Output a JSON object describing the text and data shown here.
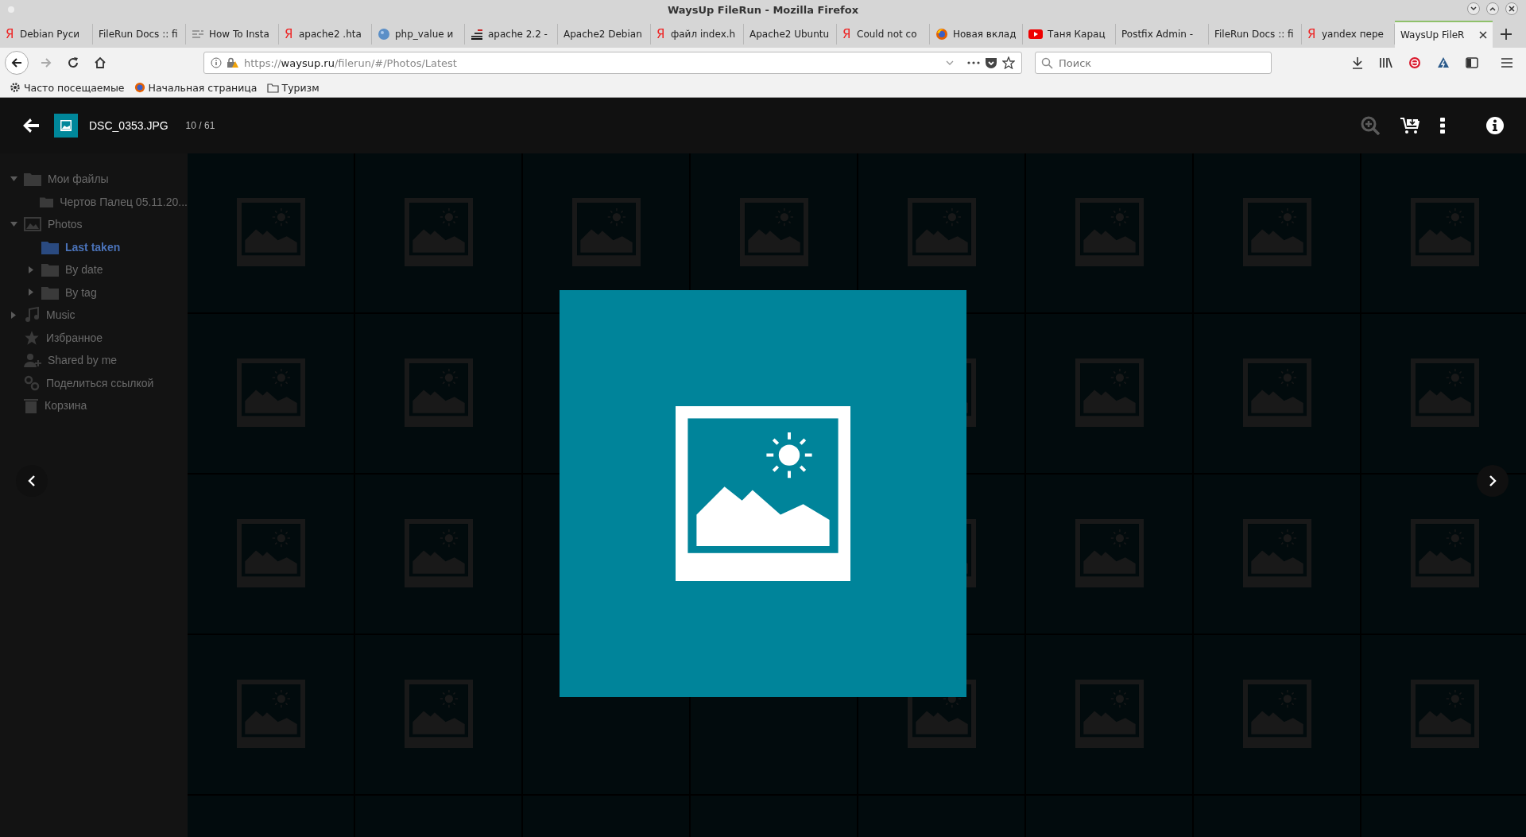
{
  "window": {
    "title": "WaysUp FileRun - Mozilla Firefox"
  },
  "tabs": [
    {
      "label": "Debian Руси",
      "kind": "yandex",
      "mark": "Я",
      "selected": false
    },
    {
      "label": "FileRun Docs :: fi",
      "kind": "plain",
      "selected": false
    },
    {
      "label": "How To Insta",
      "kind": "lines",
      "selected": false
    },
    {
      "label": "apache2 .hta",
      "kind": "yandex",
      "mark": "Я",
      "selected": false
    },
    {
      "label": "php_value и",
      "kind": "globe",
      "selected": false
    },
    {
      "label": "apache 2.2 -",
      "kind": "bars",
      "selected": false
    },
    {
      "label": "Apache2 Debian",
      "kind": "plain",
      "selected": false
    },
    {
      "label": "файл index.h",
      "kind": "yandex",
      "mark": "Я",
      "selected": false
    },
    {
      "label": "Apache2 Ubuntu",
      "kind": "plain",
      "selected": false
    },
    {
      "label": "Could not co",
      "kind": "yandex",
      "mark": "Я",
      "selected": false
    },
    {
      "label": "Новая вклад",
      "kind": "firefox",
      "selected": false
    },
    {
      "label": "Таня Карац",
      "kind": "youtube",
      "selected": false
    },
    {
      "label": "Postfix Admin -",
      "kind": "plain",
      "selected": false
    },
    {
      "label": "FileRun Docs :: fi",
      "kind": "plain",
      "selected": false
    },
    {
      "label": "yandex пере",
      "kind": "yandex",
      "mark": "Я",
      "selected": false
    },
    {
      "label": "WaysUp FileR",
      "kind": "plain",
      "selected": true
    }
  ],
  "address": {
    "scheme": "https://",
    "host": "waysup.ru",
    "path": "/filerun/#/Photos/Latest"
  },
  "search": {
    "placeholder": "Поиск"
  },
  "bookmarks": [
    {
      "label": "Часто посещаемые",
      "kind": "gear"
    },
    {
      "label": "Начальная страница",
      "kind": "firefox"
    },
    {
      "label": "Туризм",
      "kind": "folder"
    }
  ],
  "sidebar": {
    "items": [
      {
        "label": "Мои файлы",
        "kind": "folder",
        "expanded": true,
        "selected": false,
        "children": [
          {
            "label": "Чертов Палец 05.11.20...",
            "kind": "folder",
            "selected": false
          }
        ]
      },
      {
        "label": "Photos",
        "kind": "photo",
        "expanded": true,
        "selected": false,
        "children": [
          {
            "label": "Last taken",
            "kind": "folder",
            "selected": true
          },
          {
            "label": "By date",
            "kind": "folder",
            "expanded": false,
            "selected": false
          },
          {
            "label": "By tag",
            "kind": "folder",
            "expanded": false,
            "selected": false
          }
        ]
      },
      {
        "label": "Music",
        "kind": "music",
        "expanded": false,
        "selected": false
      },
      {
        "label": "Избранное",
        "kind": "star",
        "selected": false
      },
      {
        "label": "Shared by me",
        "kind": "user",
        "selected": false
      },
      {
        "label": "Поделиться ссылкой",
        "kind": "link",
        "selected": false
      },
      {
        "label": "Корзина",
        "kind": "trash",
        "selected": false
      }
    ]
  },
  "viewer": {
    "filename": "DSC_0353.JPG",
    "counter": "10 / 61",
    "zoom_disabled": true
  }
}
